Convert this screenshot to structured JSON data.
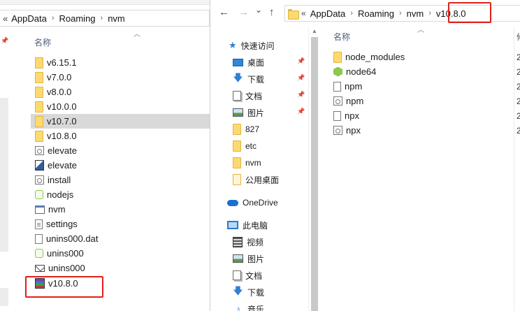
{
  "left_window": {
    "address": {
      "chevron": "«",
      "crumbs": [
        "AppData",
        "Roaming",
        "nvm"
      ]
    },
    "column_header": "名称",
    "items": [
      {
        "label": "v6.15.1",
        "icon": "folder-icon"
      },
      {
        "label": "v7.0.0",
        "icon": "folder-icon"
      },
      {
        "label": "v8.0.0",
        "icon": "folder-icon"
      },
      {
        "label": "v10.0.0",
        "icon": "folder-icon"
      },
      {
        "label": "v10.7.0",
        "icon": "folder-icon",
        "selected": true
      },
      {
        "label": "v10.8.0",
        "icon": "folder-icon"
      },
      {
        "label": "elevate",
        "icon": "script-icon"
      },
      {
        "label": "elevate",
        "icon": "elevate-exe-icon"
      },
      {
        "label": "install",
        "icon": "command-icon"
      },
      {
        "label": "nodejs",
        "icon": "node-shortcut-icon"
      },
      {
        "label": "nvm",
        "icon": "exe-icon"
      },
      {
        "label": "settings",
        "icon": "text-file-icon"
      },
      {
        "label": "unins000.dat",
        "icon": "file-icon"
      },
      {
        "label": "unins000",
        "icon": "node-shortcut-icon"
      },
      {
        "label": "unins000",
        "icon": "mail-icon"
      },
      {
        "label": "v10.8.0",
        "icon": "rar-archive-icon",
        "highlighted": true
      }
    ]
  },
  "right_window": {
    "nav": {
      "back": "←",
      "forward": "→",
      "dropdown": "⌄",
      "up": "↑"
    },
    "address": {
      "chevron": "«",
      "crumbs": [
        "AppData",
        "Roaming",
        "nvm",
        "v10.8.0"
      ]
    },
    "nav_pane": [
      {
        "label": "快速访问",
        "icon": "star-icon",
        "indent": 0
      },
      {
        "label": "桌面",
        "icon": "desktop-icon",
        "indent": 1,
        "pinned": true
      },
      {
        "label": "下载",
        "icon": "download-icon",
        "indent": 1,
        "pinned": true
      },
      {
        "label": "文档",
        "icon": "documents-icon",
        "indent": 1,
        "pinned": true
      },
      {
        "label": "图片",
        "icon": "pictures-icon",
        "indent": 1,
        "pinned": true
      },
      {
        "label": "827",
        "icon": "folder-icon",
        "indent": 1
      },
      {
        "label": "etc",
        "icon": "folder-icon",
        "indent": 1
      },
      {
        "label": "nvm",
        "icon": "folder-icon",
        "indent": 1
      },
      {
        "label": "公用桌面",
        "icon": "tall-folder-icon",
        "indent": 1
      },
      {
        "label": "OneDrive",
        "icon": "cloud-icon",
        "indent": 0
      },
      {
        "label": "此电脑",
        "icon": "pc-icon",
        "indent": 0
      },
      {
        "label": "视频",
        "icon": "video-icon",
        "indent": 1
      },
      {
        "label": "图片",
        "icon": "pictures-icon",
        "indent": 1
      },
      {
        "label": "文档",
        "icon": "documents-icon",
        "indent": 1
      },
      {
        "label": "下载",
        "icon": "download-icon",
        "indent": 1
      },
      {
        "label": "音乐",
        "icon": "music-icon",
        "indent": 1
      }
    ],
    "column_header": "名称",
    "second_column_header": "修",
    "items": [
      {
        "label": "node_modules",
        "icon": "folder-icon",
        "col2": "2"
      },
      {
        "label": "node64",
        "icon": "node-icon",
        "col2": "2"
      },
      {
        "label": "npm",
        "icon": "file-icon",
        "col2": "2"
      },
      {
        "label": "npm",
        "icon": "command-icon",
        "col2": "2"
      },
      {
        "label": "npx",
        "icon": "file-icon",
        "col2": "2"
      },
      {
        "label": "npx",
        "icon": "command-icon",
        "col2": "2"
      }
    ]
  },
  "colors": {
    "highlight_box": "#e0201b",
    "selection": "#d9d9d9",
    "header_text": "#4c607a"
  }
}
